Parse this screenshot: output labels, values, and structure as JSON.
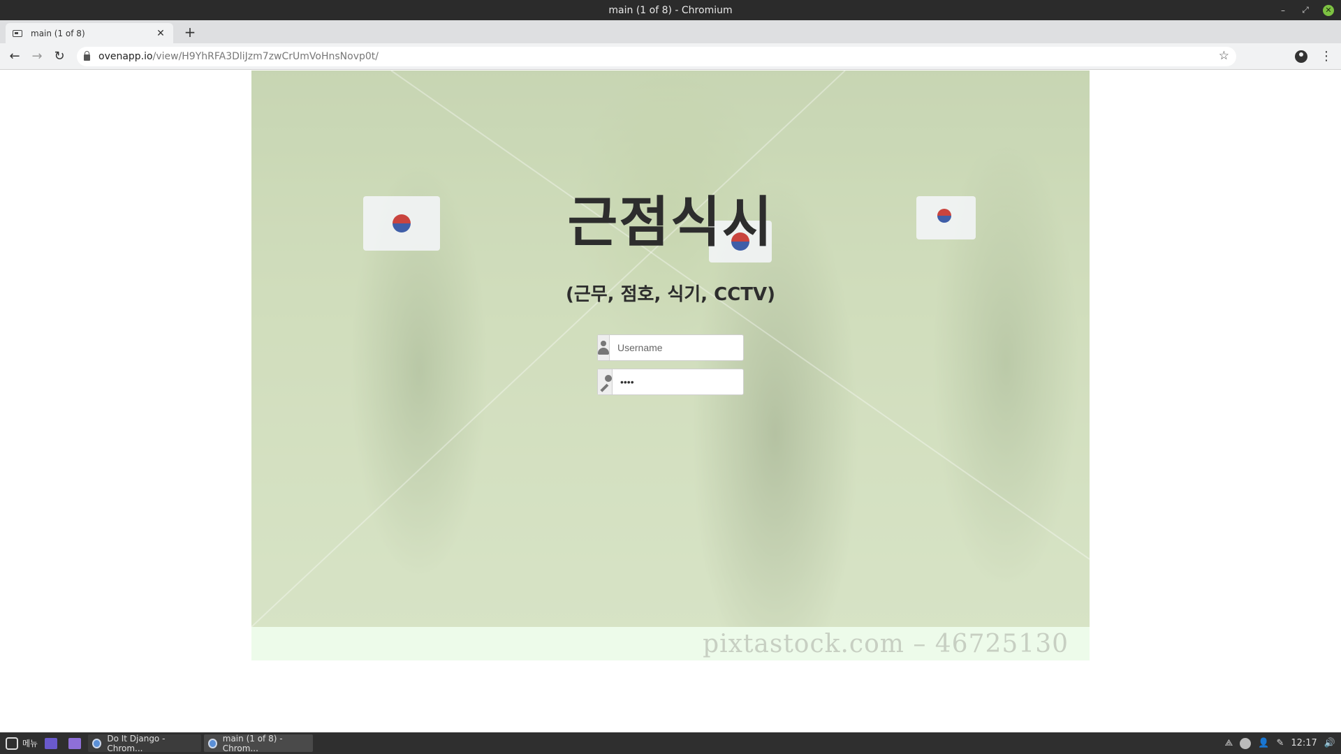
{
  "window": {
    "title": "main (1 of 8) - Chromium"
  },
  "tabs": [
    {
      "label": "main (1 of 8)"
    }
  ],
  "toolbar": {
    "url_host": "ovenapp.io",
    "url_path": "/view/H9YhRFA3DliJzm7zwCrUmVoHnsNovp0t/"
  },
  "page": {
    "title": "근점식시",
    "subtitle": "(근무, 점호, 식기, CCTV)",
    "username_placeholder": "Username",
    "password_value": "••••",
    "watermark": "pixtastock.com – 46725130"
  },
  "taskbar": {
    "menu_label": "메뉴",
    "windows": [
      {
        "label": "Do It Django - Chrom..."
      },
      {
        "label": "main (1 of 8) - Chrom..."
      }
    ],
    "clock": "12:17"
  },
  "colors": {
    "title_text": "#2d2d2d",
    "hero_tint": "#e2eed2",
    "watermark_strip": "#edfbea"
  }
}
